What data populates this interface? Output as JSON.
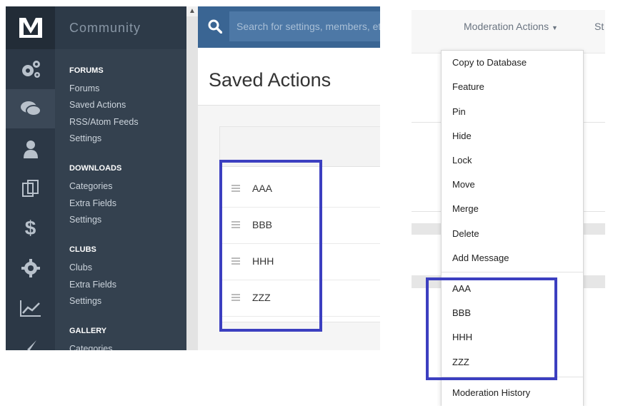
{
  "admin": {
    "section_title": "Community",
    "search": {
      "placeholder": "Search for settings, members, et"
    },
    "page_title": "Saved Actions",
    "nav_icons": [
      "gears-icon",
      "chat-icon",
      "user-icon",
      "copy-icon",
      "dollar-icon",
      "gear-icon",
      "chart-icon",
      "brush-icon"
    ],
    "sections": [
      {
        "title": "FORUMS",
        "links": [
          "Forums",
          "Saved Actions",
          "RSS/Atom Feeds",
          "Settings"
        ]
      },
      {
        "title": "DOWNLOADS",
        "links": [
          "Categories",
          "Extra Fields",
          "Settings"
        ]
      },
      {
        "title": "CLUBS",
        "links": [
          "Clubs",
          "Extra Fields",
          "Settings"
        ]
      },
      {
        "title": "GALLERY",
        "links": [
          "Categories"
        ]
      }
    ],
    "saved_actions": [
      "AAA",
      "BBB",
      "HHH",
      "ZZZ"
    ]
  },
  "moderation": {
    "button_label": "Moderation Actions",
    "next_tab_partial": "St",
    "menu_items": [
      "Copy to Database",
      "Feature",
      "Pin",
      "Hide",
      "Lock",
      "Move",
      "Merge",
      "Delete",
      "Add Message"
    ],
    "saved_items": [
      "AAA",
      "BBB",
      "HHH",
      "ZZZ"
    ],
    "history_label": "Moderation History"
  },
  "highlight_color": "#3c3fc0"
}
